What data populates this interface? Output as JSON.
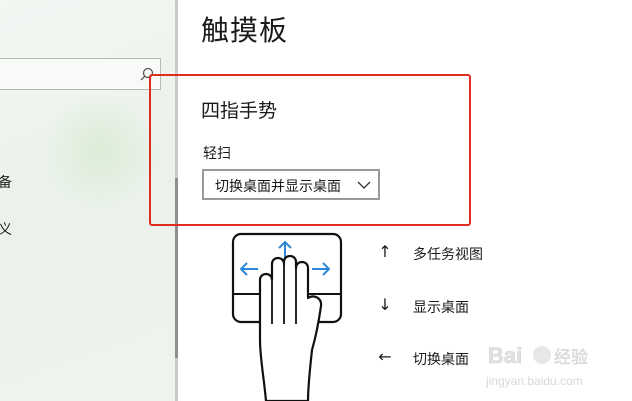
{
  "window": {
    "title": "触摸板"
  },
  "sidebar": {
    "search_placeholder": "",
    "partial_item_1": "备",
    "partial_item_2": "义"
  },
  "gesture": {
    "section_title": "四指手势",
    "swipe_label": "轻扫",
    "swipe_dropdown_value": "切换桌面并显示桌面"
  },
  "legend": [
    {
      "arrow": "↑",
      "icon": "arrow-up-icon",
      "label": "多任务视图"
    },
    {
      "arrow": "↓",
      "icon": "arrow-down-icon",
      "label": "显示桌面"
    },
    {
      "arrow": "←",
      "icon": "arrow-left-icon",
      "label": "切换桌面"
    }
  ],
  "watermark": {
    "brand": "Baidu 经验",
    "url": "jingyan.baidu.com"
  },
  "colors": {
    "highlight": "#e02c1f",
    "touchpad_arrow": "#2b88d8"
  }
}
